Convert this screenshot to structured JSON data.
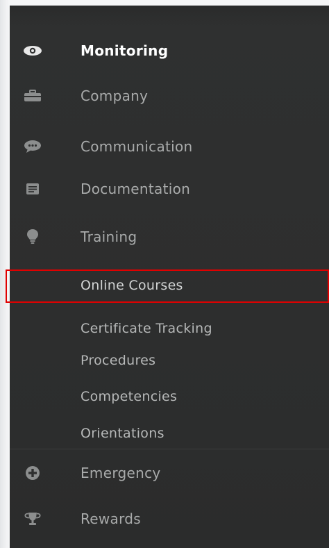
{
  "nav": {
    "monitoring": {
      "label": "Monitoring",
      "icon": "eye-icon"
    },
    "company": {
      "label": "Company",
      "icon": "briefcase-icon"
    },
    "communication": {
      "label": "Communication",
      "icon": "chat-bubble-icon"
    },
    "documentation": {
      "label": "Documentation",
      "icon": "document-icon"
    },
    "training": {
      "label": "Training",
      "icon": "lightbulb-icon",
      "subitems": [
        {
          "label": "Online Courses",
          "highlighted": true
        },
        {
          "label": "Certificate Tracking"
        },
        {
          "label": "Procedures"
        },
        {
          "label": "Competencies"
        },
        {
          "label": "Orientations"
        }
      ]
    },
    "emergency": {
      "label": "Emergency",
      "icon": "plus-circle-icon"
    },
    "rewards": {
      "label": "Rewards",
      "icon": "trophy-icon"
    }
  },
  "colors": {
    "sidebar_bg": "#2e2f2f",
    "active_text": "#ffffff",
    "inactive_text": "#a9abab",
    "icon_color": "#8c8e8e",
    "highlight_border": "#e00000"
  }
}
